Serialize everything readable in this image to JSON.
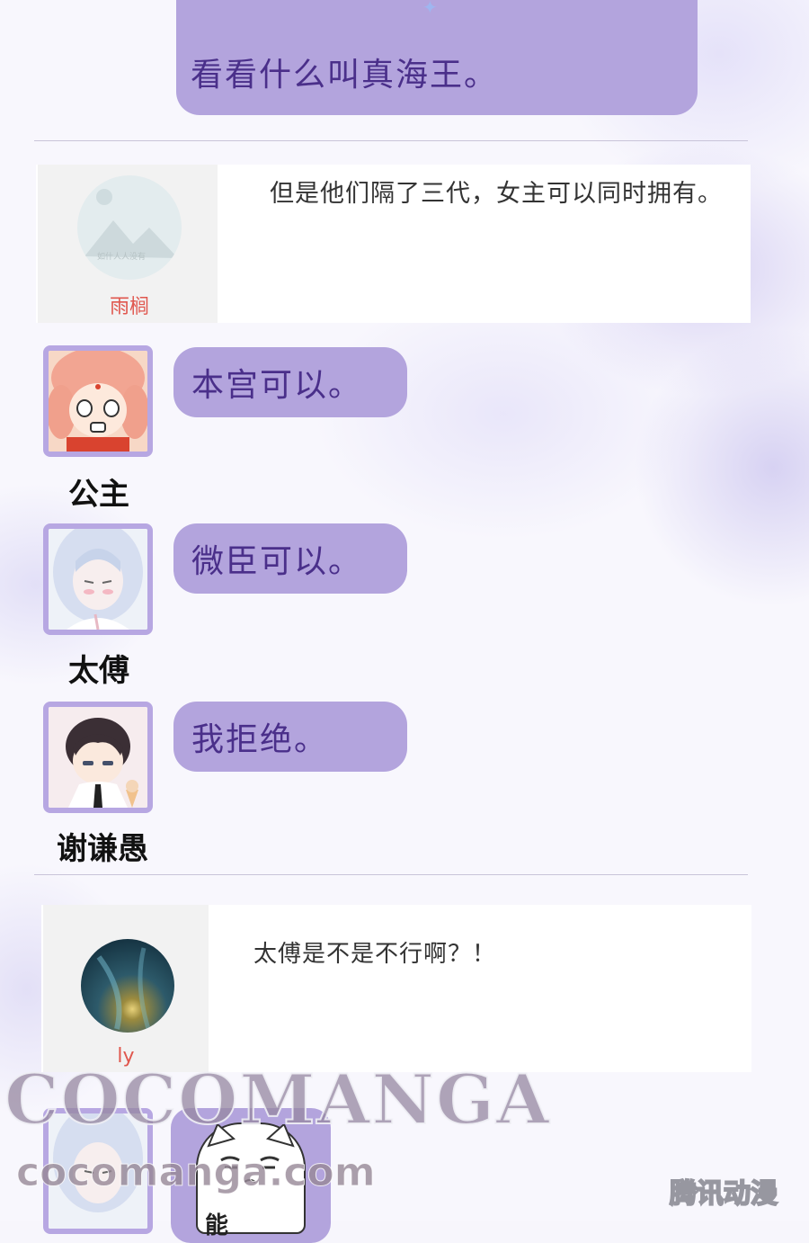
{
  "top_message": {
    "text": "看看什么叫真海王。"
  },
  "comment_1": {
    "username": "雨榈",
    "text": "但是他们隔了三代，女主可以同时拥有。",
    "avatar_caption": "如什人人没有"
  },
  "messages": [
    {
      "speaker": "公主",
      "text": "本宫可以。"
    },
    {
      "speaker": "太傅",
      "text": "微臣可以。"
    },
    {
      "speaker": "谢谦愚",
      "text": "我拒绝。"
    }
  ],
  "comment_2": {
    "username": "ly",
    "text": "太傅是不是不行啊？！"
  },
  "bottom_sticker": {
    "partial_text": "能"
  },
  "watermarks": {
    "brand": "COCOMANGA",
    "url": "cocomanga.com",
    "publisher": "腾讯动漫"
  },
  "colors": {
    "bubble": "#b3a4dd",
    "bubble_text": "#4a2f8a",
    "frame": "#b7a7e2",
    "comment_username": "#e0574e"
  }
}
